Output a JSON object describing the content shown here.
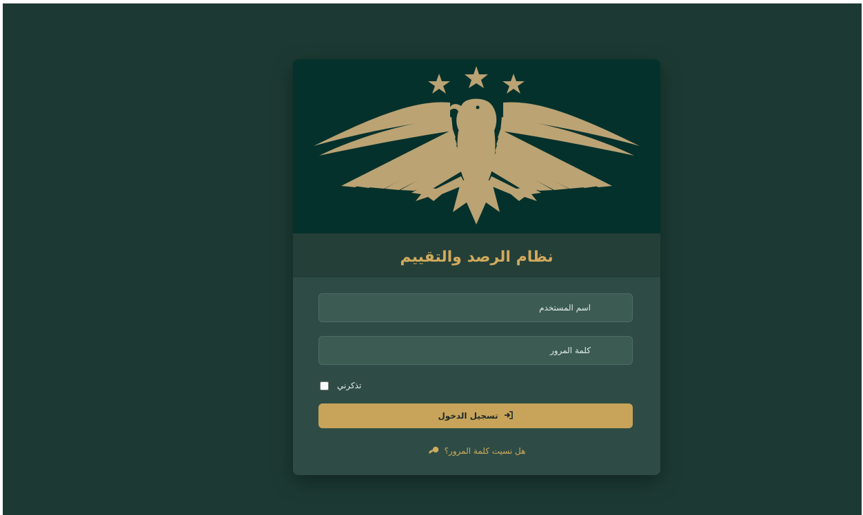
{
  "app": {
    "title": "نظام الرصد والتقييم"
  },
  "login": {
    "username_placeholder": "اسم المستخدم",
    "password_placeholder": "كلمة المرور",
    "remember_label": "تذكرني",
    "remember_checked": false,
    "submit_label": "تسجيل الدخول",
    "submit_icon": "sign-in-icon",
    "forgot_label": "هل نسيت كلمة المرور؟",
    "forgot_icon": "key-icon"
  },
  "emblem": {
    "icon": "eagle-emblem-icon",
    "stars": 3
  },
  "colors": {
    "page_background": "#1c3a33",
    "card_background": "#2e4c45",
    "emblem_background": "#05312c",
    "accent_gold": "#c8a45a",
    "title_gold": "#d1aa5c",
    "input_background": "#3b5b53"
  }
}
